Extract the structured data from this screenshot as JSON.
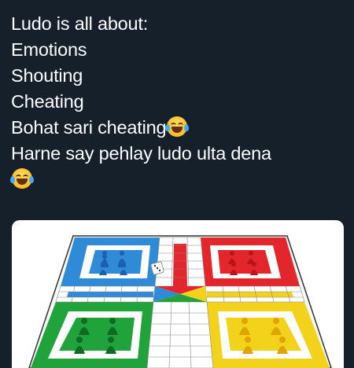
{
  "post": {
    "lines": [
      "Ludo is all about:",
      "Emotions",
      "Shouting",
      "Cheating",
      "Bohat sari cheating",
      "Harne say pehlay ludo ulta dena"
    ],
    "emoji": "face-with-tears-of-joy"
  },
  "image": {
    "subject": "ludo-board",
    "colors": {
      "blue": "#2f8ad8",
      "red": "#e3262b",
      "green": "#1fa33a",
      "yellow": "#f2d21a"
    }
  }
}
